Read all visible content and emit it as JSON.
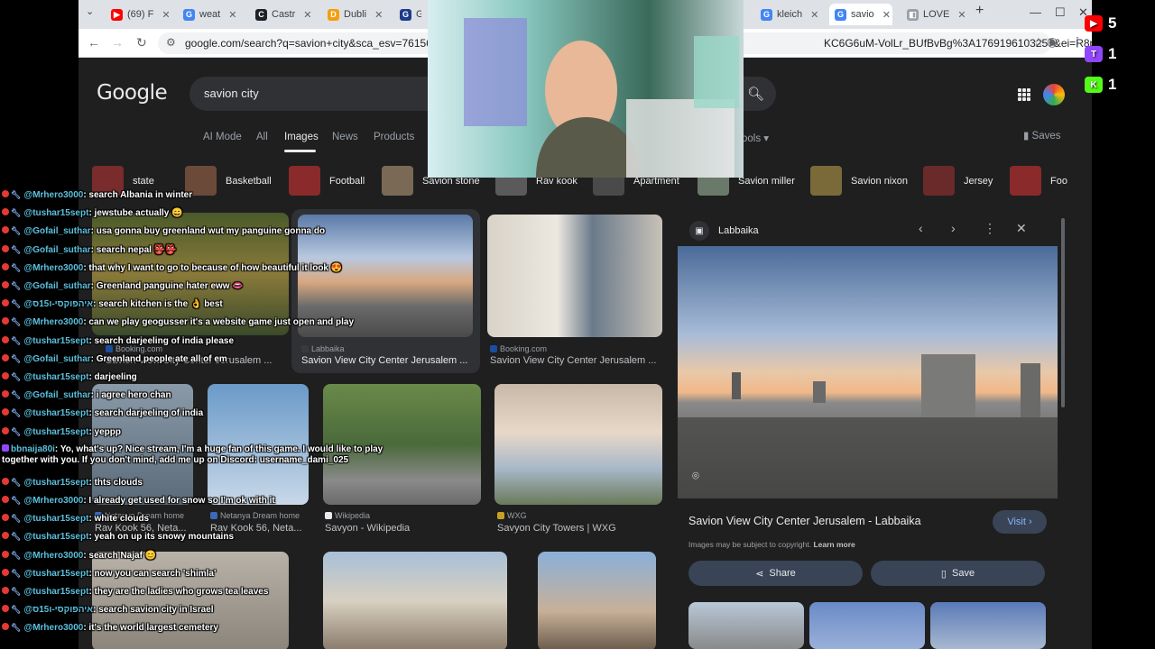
{
  "browser": {
    "tabs": [
      {
        "label": "(69) F",
        "icon_color": "#ff0000",
        "icon_name": "youtube-icon",
        "glyph": "▶"
      },
      {
        "label": "weat",
        "icon_color": "#4285f4",
        "icon_name": "google-icon",
        "glyph": "G"
      },
      {
        "label": "Castr",
        "icon_color": "#202124",
        "icon_name": "castr-icon",
        "glyph": "C"
      },
      {
        "label": "Dubli",
        "icon_color": "#f59e0b",
        "icon_name": "dublin-icon",
        "glyph": "D"
      },
      {
        "label": "Ga",
        "icon_color": "#1e3a8a",
        "icon_name": "game-icon",
        "glyph": "G"
      },
      {
        "label": "kleich",
        "icon_color": "#4285f4",
        "icon_name": "google-icon",
        "glyph": "G"
      },
      {
        "label": "savio",
        "icon_color": "#4285f4",
        "icon_name": "google-icon",
        "glyph": "G"
      },
      {
        "label": "LOVE",
        "icon_color": "#9aa0a6",
        "icon_name": "page-icon",
        "glyph": "◧"
      }
    ],
    "url_left": "google.com/search?q=savion+city&sca_esv=76156e36",
    "url_right": "KC6G6uM-VolLr_BUfBvBg%3A1769196103257&ei=R8pza..."
  },
  "google": {
    "logo": "Google",
    "query": "savion city",
    "tabs": [
      "AI Mode",
      "All",
      "Images",
      "News",
      "Products"
    ],
    "active_tab": "Images",
    "tools": "ools",
    "saves": "Saves",
    "chips": [
      {
        "label": "state",
        "color": "#7a2b2b"
      },
      {
        "label": "Basketball",
        "color": "#6b4a3a"
      },
      {
        "label": "Football",
        "color": "#8a2a2a"
      },
      {
        "label": "Savion stone",
        "color": "#7a6a55"
      },
      {
        "label": "Rav kook",
        "color": "#5a5a5a"
      },
      {
        "label": "Apartment",
        "color": "#4a4a4a"
      },
      {
        "label": "Savion miller",
        "color": "#6a7a6a"
      },
      {
        "label": "Savion nixon",
        "color": "#7a6a3a"
      },
      {
        "label": "Jersey",
        "color": "#6a2a2a"
      },
      {
        "label": "Foo",
        "color": "#8a2a2a"
      }
    ],
    "results": [
      {
        "source": "Booking.com",
        "title": "Savion View City Center Jerusalem ..."
      },
      {
        "source": "Labbaika",
        "title": "Savion View City Center Jerusalem ..."
      },
      {
        "source": "Booking.com",
        "title": "Savion View City Center Jerusalem ..."
      },
      {
        "source": "Netanya Dream home",
        "title": "Rav Kook 56, Neta..."
      },
      {
        "source": "Netanya Dream home",
        "title": "Rav Kook 56, Neta..."
      },
      {
        "source": "Wikipedia",
        "title": "Savyon - Wikipedia"
      },
      {
        "source": "WXG",
        "title": "Savyon City Towers | WXG"
      }
    ],
    "panel": {
      "source": "Labbaika",
      "title": "Savion View City Center Jerusalem - Labbaika",
      "visit": "Visit",
      "copyright": "Images may be subject to copyright.",
      "learn_more": "Learn more",
      "share": "Share",
      "save": "Save"
    }
  },
  "chat": [
    {
      "user": "@Mrhero3000",
      "text": ": search Albania in winter",
      "badge": "yt"
    },
    {
      "user": "@tushar15sept",
      "text": ": jewstube actually 😄",
      "badge": "yt"
    },
    {
      "user": "@Gofail_suthar",
      "text": ": usa gonna buy greenland wut my panguine gonna do",
      "badge": "yt"
    },
    {
      "user": "@Gofail_suthar",
      "text": ": search nepal 👺👺",
      "badge": "yt"
    },
    {
      "user": "@Mrhero3000",
      "text": ": that why I want to go to because of how beautiful it look 😍",
      "badge": "yt"
    },
    {
      "user": "@Gofail_suthar",
      "text": ": Greenland panguine hater eww 👄",
      "badge": "yt"
    },
    {
      "user": "@איהפוקסי-ו15ס",
      "text": ": search kitchen is the 👌 best",
      "badge": "yt"
    },
    {
      "user": "@Mrhero3000",
      "text": ": can we play geogusser it's a website game just open and play",
      "badge": "yt"
    },
    {
      "user": "@tushar15sept",
      "text": ": search darjeeling of india please",
      "badge": "yt"
    },
    {
      "user": "@Gofail_suthar",
      "text": ": Greenland people ate all of em",
      "badge": "yt"
    },
    {
      "user": "@tushar15sept",
      "text": ": darjeeling",
      "badge": "yt"
    },
    {
      "user": "@Gofail_suthar",
      "text": ": i agree hero chan",
      "badge": "yt"
    },
    {
      "user": "@tushar15sept",
      "text": ": search darjeeling of india",
      "badge": "yt"
    },
    {
      "user": "@tushar15sept",
      "text": ": yeppp",
      "badge": "yt"
    },
    {
      "user": "bbnaija80i",
      "text": ": Yo, what's up? Nice stream, I'm a huge fan of this game. I would like to play together with you. If you don't mind, add me up on Discord: username_dami_025",
      "badge": "twitch"
    },
    {
      "user": "@tushar15sept",
      "text": ": thts clouds",
      "badge": "yt"
    },
    {
      "user": "@Mrhero3000",
      "text": ": I already get used for snow so I'm ok with it",
      "badge": "yt"
    },
    {
      "user": "@tushar15sept",
      "text": ": white clouds",
      "badge": "yt"
    },
    {
      "user": "@tushar15sept",
      "text": ": yeah on up its snowy mountains",
      "badge": "yt"
    },
    {
      "user": "@Mrhero3000",
      "text": ": search Najaf 😊",
      "badge": "yt"
    },
    {
      "user": "@tushar15sept",
      "text": ": now you can search 'shimla'",
      "badge": "yt"
    },
    {
      "user": "@tushar15sept",
      "text": ": they are the ladies who grows tea leaves",
      "badge": "yt"
    },
    {
      "user": "@איהפוקסי-ו15ס",
      "text": ": search savion city in Israel",
      "badge": "yt"
    },
    {
      "user": "@Mrhero3000",
      "text": ": it's the world largest cemetery",
      "badge": "yt"
    }
  ],
  "counters": [
    {
      "platform": "youtube",
      "count": "5",
      "color": "#ff0000",
      "glyph": "▶"
    },
    {
      "platform": "twitch",
      "count": "1",
      "color": "#9146ff",
      "glyph": "T"
    },
    {
      "platform": "kick",
      "count": "1",
      "color": "#53fc18",
      "glyph": "K"
    }
  ]
}
